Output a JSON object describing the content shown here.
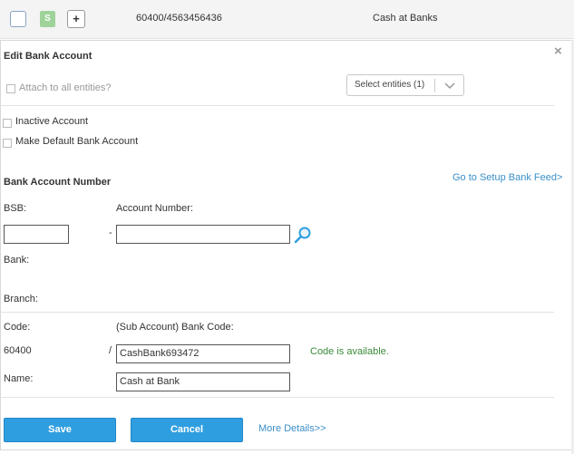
{
  "row": {
    "status_badge": "S",
    "expand_button": "+",
    "account_code": "60400/4563456436",
    "account_name": "Cash at Banks"
  },
  "panel": {
    "close": "×",
    "title": "Edit Bank Account",
    "attach_all_label": "Attach to all entities?",
    "entity_select": "Select entities (1)",
    "inactive_label": "Inactive Account",
    "default_label": "Make Default Bank Account",
    "section_title": "Bank Account Number",
    "setup_feed_link": "Go to Setup Bank Feed>",
    "bsb_label": "BSB:",
    "bsb_value": "",
    "dash": "-",
    "account_number_label": "Account Number:",
    "account_number_value": "",
    "search_icon": "magnifier-icon",
    "bank_label": "Bank:",
    "branch_label": "Branch:",
    "code_label": "Code:",
    "sub_code_label": "(Sub Account) Bank Code:",
    "code_value": "60400",
    "slash": "/",
    "sub_code_value": "CashBank693472",
    "availability": "Code is available.",
    "name_label": "Name:",
    "name_value": "Cash at Bank",
    "save_label": "Save",
    "cancel_label": "Cancel",
    "more_details_link": "More Details>>"
  },
  "colors": {
    "accent": "#2f9ee0",
    "link": "#3b8fc9",
    "success": "#3a8a3a",
    "badge": "#9fd39a"
  }
}
